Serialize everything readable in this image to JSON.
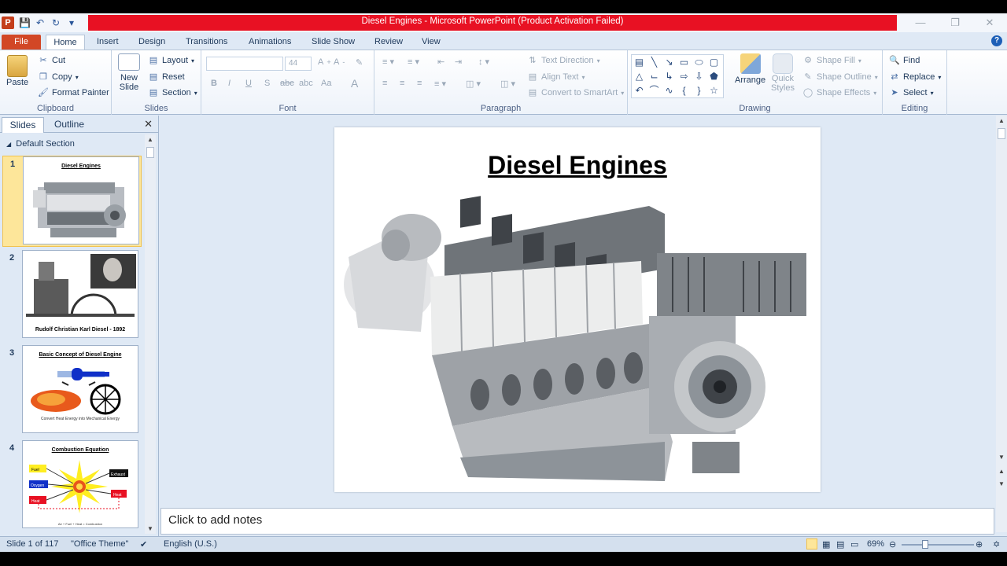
{
  "window": {
    "title": "Diesel Engines  -  Microsoft PowerPoint (Product Activation Failed)",
    "app_icon": "P"
  },
  "tabs": [
    {
      "label": "File"
    },
    {
      "label": "Home"
    },
    {
      "label": "Insert"
    },
    {
      "label": "Design"
    },
    {
      "label": "Transitions"
    },
    {
      "label": "Animations"
    },
    {
      "label": "Slide Show"
    },
    {
      "label": "Review"
    },
    {
      "label": "View"
    }
  ],
  "ribbon": {
    "clipboard": {
      "label": "Clipboard",
      "paste": "Paste",
      "cut": "Cut",
      "copy": "Copy",
      "format_painter": "Format Painter"
    },
    "slides": {
      "label": "Slides",
      "new_slide": "New",
      "new_slide2": "Slide",
      "layout": "Layout",
      "reset": "Reset",
      "section": "Section"
    },
    "font": {
      "label": "Font",
      "font_name": "",
      "font_size": "44",
      "bold": "B",
      "italic": "I",
      "underline": "U",
      "strike": "S",
      "spacing": "abc",
      "change_case": "Aa",
      "color": "A"
    },
    "paragraph": {
      "label": "Paragraph",
      "text_direction": "Text Direction",
      "align_text": "Align Text",
      "convert_smartart": "Convert to SmartArt"
    },
    "drawing": {
      "label": "Drawing",
      "arrange": "Arrange",
      "quick_styles": "Quick",
      "quick_styles2": "Styles",
      "shape_fill": "Shape Fill",
      "shape_outline": "Shape Outline",
      "shape_effects": "Shape Effects"
    },
    "editing": {
      "label": "Editing",
      "find": "Find",
      "replace": "Replace",
      "select": "Select"
    }
  },
  "panel": {
    "tab_slides": "Slides",
    "tab_outline": "Outline",
    "section": "Default Section",
    "thumbnails": [
      {
        "num": "1",
        "title": "Diesel Engines",
        "caption": ""
      },
      {
        "num": "2",
        "title": "",
        "caption": "Rudolf Christian Karl Diesel - 1892"
      },
      {
        "num": "3",
        "title": "Basic Concept of Diesel Engine",
        "caption": "Convert Heat Energy into Mechanical Energy"
      },
      {
        "num": "4",
        "title": "Combustion Equation",
        "caption": "Air + Fuel + Heat = Combustion"
      }
    ],
    "thumb4_labels": {
      "fuel": "Fuel",
      "oxygen": "Oxygen",
      "heat_left": "Heat",
      "exhaust": "Exhaust",
      "heat_right": "Heat"
    }
  },
  "slide": {
    "title": "Diesel Engines"
  },
  "notes": {
    "placeholder": "Click to add notes"
  },
  "status": {
    "slide_count": "Slide 1 of 117",
    "theme": "\"Office Theme\"",
    "language": "English (U.S.)",
    "zoom": "69%"
  }
}
